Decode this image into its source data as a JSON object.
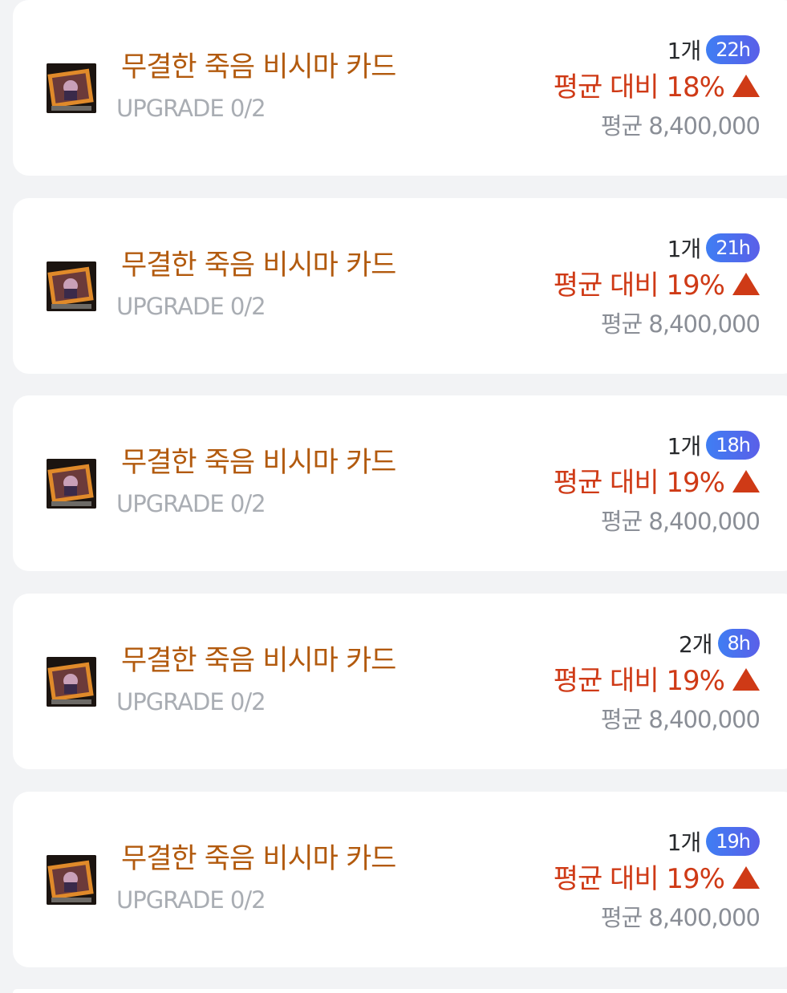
{
  "colors": {
    "background": "#f2f3f5",
    "card": "#ffffff",
    "item_name": "#b25a0e",
    "upgrade_text": "#a9adb3",
    "compare_up": "#cf3a16",
    "average_text": "#8a8e96",
    "badge_gradient_start": "#3f7ef3",
    "badge_gradient_end": "#5a5fe8"
  },
  "listings": [
    {
      "icon": "bishima-card-icon",
      "name": "무결한 죽음 비시마 카드",
      "upgrade": "UPGRADE 0/2",
      "quantity": "1개",
      "time": "22h",
      "compare": "평균 대비 18%",
      "trend": "up",
      "average": "평균 8,400,000"
    },
    {
      "icon": "bishima-card-icon",
      "name": "무결한 죽음 비시마 카드",
      "upgrade": "UPGRADE 0/2",
      "quantity": "1개",
      "time": "21h",
      "compare": "평균 대비 19%",
      "trend": "up",
      "average": "평균 8,400,000"
    },
    {
      "icon": "bishima-card-icon",
      "name": "무결한 죽음 비시마 카드",
      "upgrade": "UPGRADE 0/2",
      "quantity": "1개",
      "time": "18h",
      "compare": "평균 대비 19%",
      "trend": "up",
      "average": "평균 8,400,000"
    },
    {
      "icon": "bishima-card-icon",
      "name": "무결한 죽음 비시마 카드",
      "upgrade": "UPGRADE 0/2",
      "quantity": "2개",
      "time": "8h",
      "compare": "평균 대비 19%",
      "trend": "up",
      "average": "평균 8,400,000"
    },
    {
      "icon": "bishima-card-icon",
      "name": "무결한 죽음 비시마 카드",
      "upgrade": "UPGRADE 0/2",
      "quantity": "1개",
      "time": "19h",
      "compare": "평균 대비 19%",
      "trend": "up",
      "average": "평균 8,400,000"
    }
  ]
}
